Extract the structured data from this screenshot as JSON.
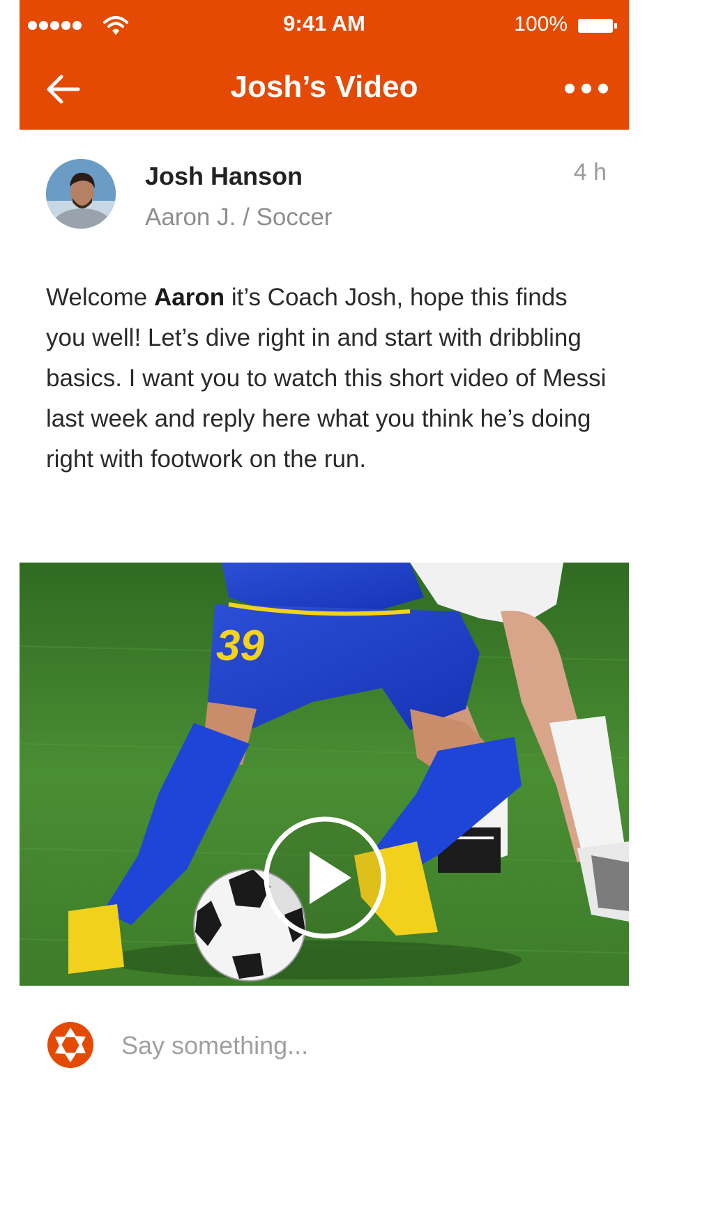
{
  "status_bar": {
    "time": "9:41 AM",
    "battery": "100%"
  },
  "nav": {
    "title": "Josh’s Video"
  },
  "post": {
    "author_name": "Josh Hanson",
    "author_sub": "Aaron J. / Soccer",
    "time": "4 h",
    "body_intro": "Welcome ",
    "body_name": "Aaron",
    "body_rest": " it’s Coach Josh, hope this finds you well! Let’s dive right in and start with dribbling basics. I want you to watch this short video of Messi last week and reply here what you think he’s doing right with footwork on the run."
  },
  "video": {
    "jersey_number": "39"
  },
  "comment": {
    "placeholder": "Say something..."
  },
  "colors": {
    "brand": "#e54a05",
    "text": "#2a2a2a",
    "muted": "#8e8e8e"
  },
  "icons": {
    "back": "arrow-left-icon",
    "more": "more-dots-icon",
    "play": "play-icon",
    "logo": "aperture-logo-icon"
  }
}
